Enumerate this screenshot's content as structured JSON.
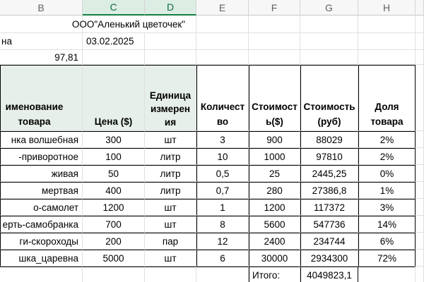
{
  "columns": [
    "B",
    "C",
    "D",
    "E",
    "F",
    "G",
    "H"
  ],
  "company": "ООО\"Аленький цветочек\"",
  "rate_label": "на",
  "rate_date": "03.02.2025",
  "rate_value": "97,81",
  "headers": {
    "name": "именование\nтовара",
    "price": "Цена ($)",
    "unit": "Единица\nизмерен\nия",
    "qty": "Количест\nво",
    "cost_usd": "Стоимост\nь($)",
    "cost_rub": "Стоимость\n(руб)",
    "share": "Доля\nтовара"
  },
  "rows": [
    {
      "name": "нка волшебная",
      "price": "300",
      "unit": "шт",
      "qty": "3",
      "cost_usd": "900",
      "cost_rub": "88029",
      "share": "2%"
    },
    {
      "name": "-приворотное",
      "price": "100",
      "unit": "литр",
      "qty": "10",
      "cost_usd": "1000",
      "cost_rub": "97810",
      "share": "2%"
    },
    {
      "name": "живая",
      "price": "50",
      "unit": "литр",
      "qty": "0,5",
      "cost_usd": "25",
      "cost_rub": "2445,25",
      "share": "0%"
    },
    {
      "name": "мертвая",
      "price": "400",
      "unit": "литр",
      "qty": "0,7",
      "cost_usd": "280",
      "cost_rub": "27386,8",
      "share": "1%"
    },
    {
      "name": "о-самолет",
      "price": "1200",
      "unit": "шт",
      "qty": "1",
      "cost_usd": "1200",
      "cost_rub": "117372",
      "share": "3%"
    },
    {
      "name": "ерть-самобранка",
      "price": "700",
      "unit": "шт",
      "qty": "8",
      "cost_usd": "5600",
      "cost_rub": "547736",
      "share": "14%"
    },
    {
      "name": "ги-скороходы",
      "price": "200",
      "unit": "пар",
      "qty": "12",
      "cost_usd": "2400",
      "cost_rub": "234744",
      "share": "6%"
    },
    {
      "name": "шка_царевна",
      "price": "5000",
      "unit": "шт",
      "qty": "6",
      "cost_usd": "30000",
      "cost_rub": "2934300",
      "share": "72%"
    }
  ],
  "total_label": "Итого:",
  "total_value": "4049823,1"
}
